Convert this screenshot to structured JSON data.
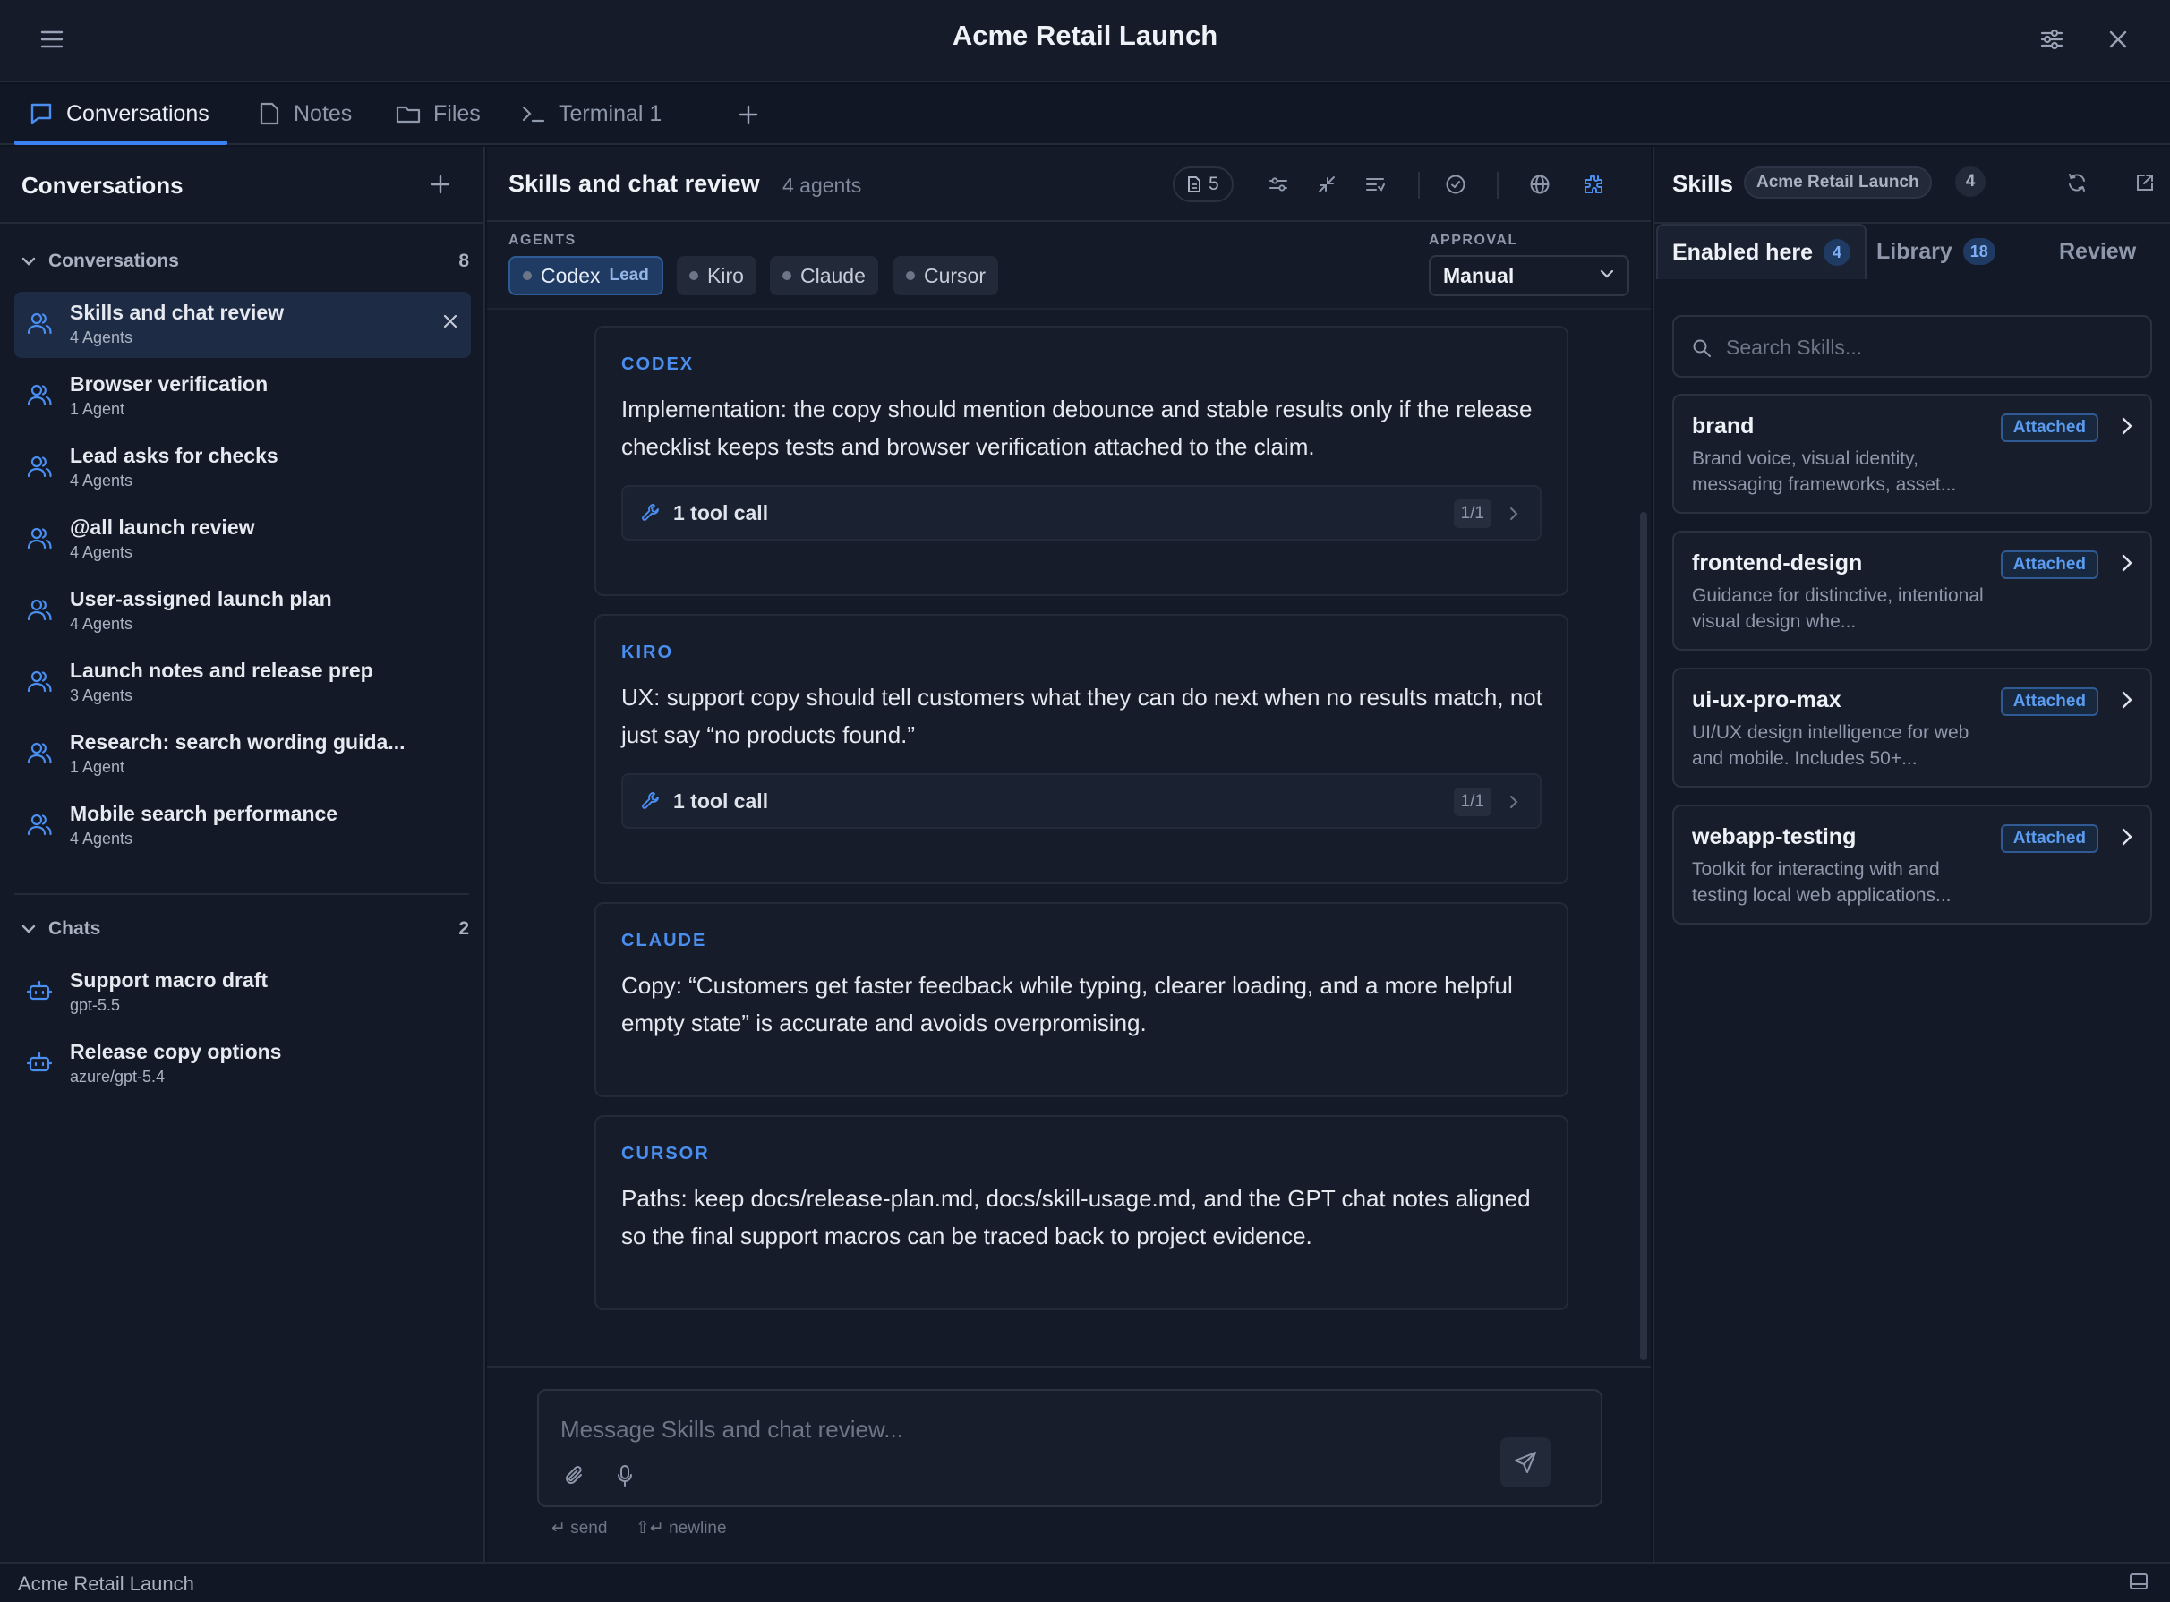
{
  "window": {
    "title": "Acme Retail Launch"
  },
  "tabs": [
    {
      "label": "Conversations",
      "icon": "chat-icon",
      "active": true
    },
    {
      "label": "Notes",
      "icon": "note-icon"
    },
    {
      "label": "Files",
      "icon": "folder-icon"
    },
    {
      "label": "Terminal 1",
      "icon": "terminal-icon"
    }
  ],
  "sidebar": {
    "title": "Conversations",
    "groups": {
      "conversations": {
        "label": "Conversations",
        "count": "8",
        "items": [
          {
            "title": "Skills and chat review",
            "sub": "4 Agents",
            "active": true
          },
          {
            "title": "Browser verification",
            "sub": "1 Agent"
          },
          {
            "title": "Lead asks for checks",
            "sub": "4 Agents"
          },
          {
            "title": "@all launch review",
            "sub": "4 Agents"
          },
          {
            "title": "User-assigned launch plan",
            "sub": "4 Agents"
          },
          {
            "title": "Launch notes and release prep",
            "sub": "3 Agents"
          },
          {
            "title": "Research: search wording guida...",
            "sub": "1 Agent"
          },
          {
            "title": "Mobile search performance",
            "sub": "4 Agents"
          }
        ]
      },
      "chats": {
        "label": "Chats",
        "count": "2",
        "items": [
          {
            "title": "Support macro draft",
            "sub": "gpt-5.5"
          },
          {
            "title": "Release copy options",
            "sub": "azure/gpt-5.4"
          }
        ]
      }
    }
  },
  "chat": {
    "title": "Skills and chat review",
    "subtitle": "4 agents",
    "doc_count": "5",
    "agents_label": "AGENTS",
    "agents": [
      {
        "name": "Codex",
        "tag": "Lead"
      },
      {
        "name": "Kiro"
      },
      {
        "name": "Claude"
      },
      {
        "name": "Cursor"
      }
    ],
    "approval_label": "APPROVAL",
    "approval_value": "Manual",
    "messages": [
      {
        "author": "CODEX",
        "text": "Implementation: the copy should mention debounce and stable results only if the release checklist keeps tests and browser verification attached to the claim.",
        "tool": {
          "label": "1 tool call",
          "count": "1/1"
        }
      },
      {
        "author": "KIRO",
        "text": "UX: support copy should tell customers what they can do next when no results match, not just say “no products found.”",
        "tool": {
          "label": "1 tool call",
          "count": "1/1"
        }
      },
      {
        "author": "CLAUDE",
        "text": "Copy: “Customers get faster feedback while typing, clearer loading, and a more helpful empty state” is accurate and avoids overpromising."
      },
      {
        "author": "CURSOR",
        "text": "Paths: keep docs/release-plan.md, docs/skill-usage.md, and the GPT chat notes aligned so the final support macros can be traced back to project evidence."
      }
    ],
    "composer": {
      "placeholder": "Message Skills and chat review...",
      "hint_send": "↵ send",
      "hint_newline": "⇧↵ newline"
    }
  },
  "skills": {
    "title": "Skills",
    "project": "Acme Retail Launch",
    "count": "4",
    "tabs": [
      {
        "label": "Enabled here",
        "badge": "4",
        "active": true
      },
      {
        "label": "Library",
        "badge": "18"
      },
      {
        "label": "Review"
      }
    ],
    "search_placeholder": "Search Skills...",
    "items": [
      {
        "name": "brand",
        "desc": "Brand voice, visual identity, messaging frameworks, asset...",
        "status": "Attached"
      },
      {
        "name": "frontend-design",
        "desc": "Guidance for distinctive, intentional visual design whe...",
        "status": "Attached"
      },
      {
        "name": "ui-ux-pro-max",
        "desc": "UI/UX design intelligence for web and mobile. Includes 50+...",
        "status": "Attached"
      },
      {
        "name": "webapp-testing",
        "desc": "Toolkit for interacting with and testing local web applications...",
        "status": "Attached"
      }
    ]
  },
  "status_bar": {
    "text": "Acme Retail Launch"
  },
  "colors": {
    "accent": "#3b82f6",
    "background": "#0f1421",
    "panel": "#131926"
  }
}
